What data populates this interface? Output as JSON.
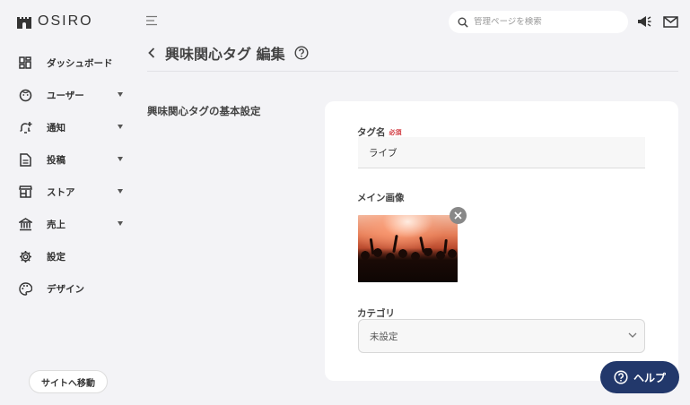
{
  "brand": {
    "name": "OSIRO"
  },
  "sidebar": {
    "items": [
      {
        "label": "ダッシュボード",
        "icon": "dashboard-icon",
        "expandable": false
      },
      {
        "label": "ユーザー",
        "icon": "user-face-icon",
        "expandable": true
      },
      {
        "label": "通知",
        "icon": "bell-plus-icon",
        "expandable": true
      },
      {
        "label": "投稿",
        "icon": "document-icon",
        "expandable": true
      },
      {
        "label": "ストア",
        "icon": "store-icon",
        "expandable": true
      },
      {
        "label": "売上",
        "icon": "bank-icon",
        "expandable": true
      },
      {
        "label": "設定",
        "icon": "gear-icon",
        "expandable": false
      },
      {
        "label": "デザイン",
        "icon": "palette-icon",
        "expandable": false
      }
    ],
    "site_button": "サイトへ移動"
  },
  "header": {
    "search_placeholder": "管理ページを検索"
  },
  "page": {
    "title": "興味関心タグ 編集",
    "section_label": "興味関心タグの基本設定"
  },
  "form": {
    "tag_name": {
      "label": "タグ名",
      "required": "必須",
      "value": "ライブ"
    },
    "main_image": {
      "label": "メイン画像"
    },
    "category": {
      "label": "カテゴリ",
      "value": "未設定"
    }
  },
  "help_button": "ヘルプ",
  "colors": {
    "background": "#f3f3f6",
    "card": "#ffffff",
    "required": "#d0343a",
    "help_button": "#22386b"
  }
}
